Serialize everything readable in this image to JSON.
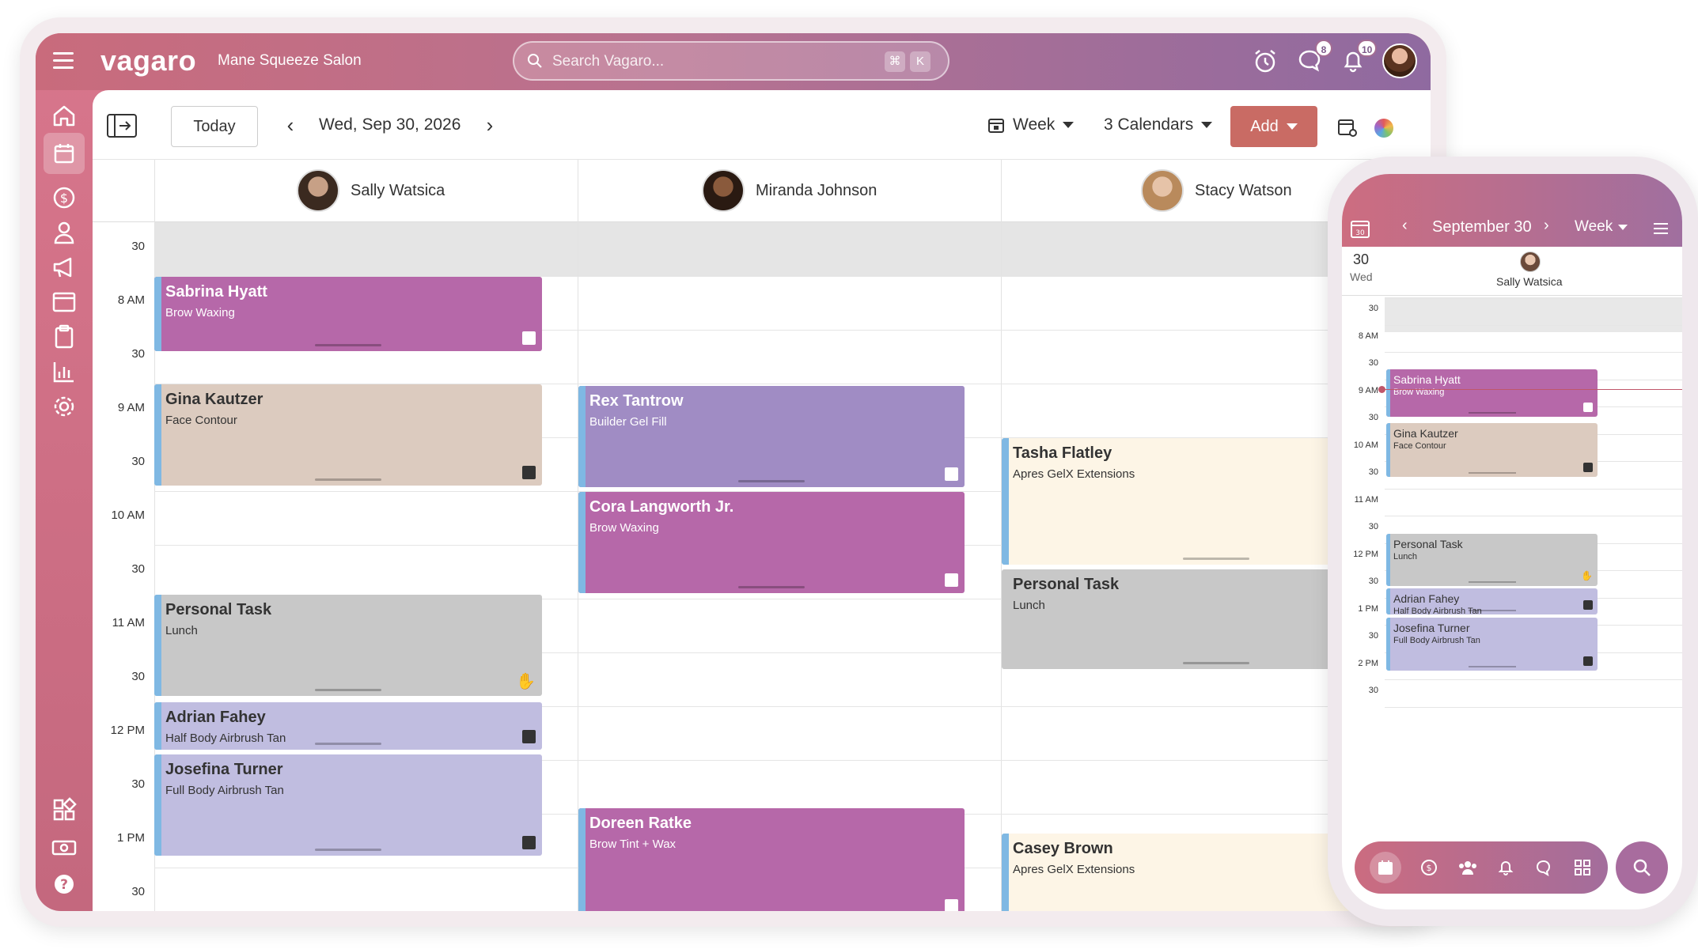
{
  "topbar": {
    "brand": "vagaro",
    "salon": "Mane Squeeze Salon",
    "search_placeholder": "Search Vagaro...",
    "shortcut_cmd": "⌘",
    "shortcut_key": "K",
    "messages_badge": "8",
    "notifications_badge": "10"
  },
  "toolbar": {
    "today": "Today",
    "date": "Wed, Sep 30, 2026",
    "view": "Week",
    "calendars": "3 Calendars",
    "add": "Add"
  },
  "staff": [
    {
      "name": "Sally Watsica"
    },
    {
      "name": "Miranda Johnson"
    },
    {
      "name": "Stacy Watson"
    }
  ],
  "time_labels": [
    "30",
    "8 AM",
    "30",
    "9 AM",
    "30",
    "10 AM",
    "30",
    "11 AM",
    "30",
    "12 PM",
    "30",
    "1 PM",
    "30"
  ],
  "appointments": [
    {
      "name": "Sabrina Hyatt",
      "service": "Brow Waxing"
    },
    {
      "name": "Gina Kautzer",
      "service": "Face Contour"
    },
    {
      "name": "Personal Task",
      "service": "Lunch"
    },
    {
      "name": "Adrian Fahey",
      "service": "Half Body Airbrush Tan"
    },
    {
      "name": "Josefina Turner",
      "service": "Full Body Airbrush Tan"
    },
    {
      "name": "Rex Tantrow",
      "service": "Builder Gel Fill"
    },
    {
      "name": "Cora Langworth Jr.",
      "service": "Brow Waxing"
    },
    {
      "name": "Doreen Ratke",
      "service": "Brow Tint + Wax"
    },
    {
      "name": "Tasha Flatley",
      "service": "Apres GelX Extensions"
    },
    {
      "name": "Personal Task",
      "service": "Lunch"
    },
    {
      "name": "Casey Brown",
      "service": "Apres GelX Extensions"
    }
  ],
  "colors": {
    "purple": "#b668a9",
    "beige": "#dccbbf",
    "gray": "#c8c8c8",
    "lavender": "#c0bde0",
    "violet": "#a08cc4",
    "cream": "#fdf5e6",
    "stripe": "#7fb8e3",
    "add_button": "#c96b64"
  },
  "phone": {
    "month_day": "September 30",
    "view": "Week",
    "day_num": "30",
    "day_name": "Wed",
    "staff": "Sally Watsica",
    "time_labels": [
      "30",
      "8 AM",
      "30",
      "9 AM",
      "30",
      "10 AM",
      "30",
      "11 AM",
      "30",
      "12 PM",
      "30",
      "1 PM",
      "30",
      "2 PM",
      "30"
    ],
    "appointments": [
      {
        "name": "Sabrina Hyatt",
        "service": "Brow Waxing"
      },
      {
        "name": "Gina Kautzer",
        "service": "Face Contour"
      },
      {
        "name": "Personal Task",
        "service": "Lunch"
      },
      {
        "name": "Adrian Fahey",
        "service": "Half Body Airbrush Tan"
      },
      {
        "name": "Josefina Turner",
        "service": "Full Body Airbrush Tan"
      }
    ]
  }
}
